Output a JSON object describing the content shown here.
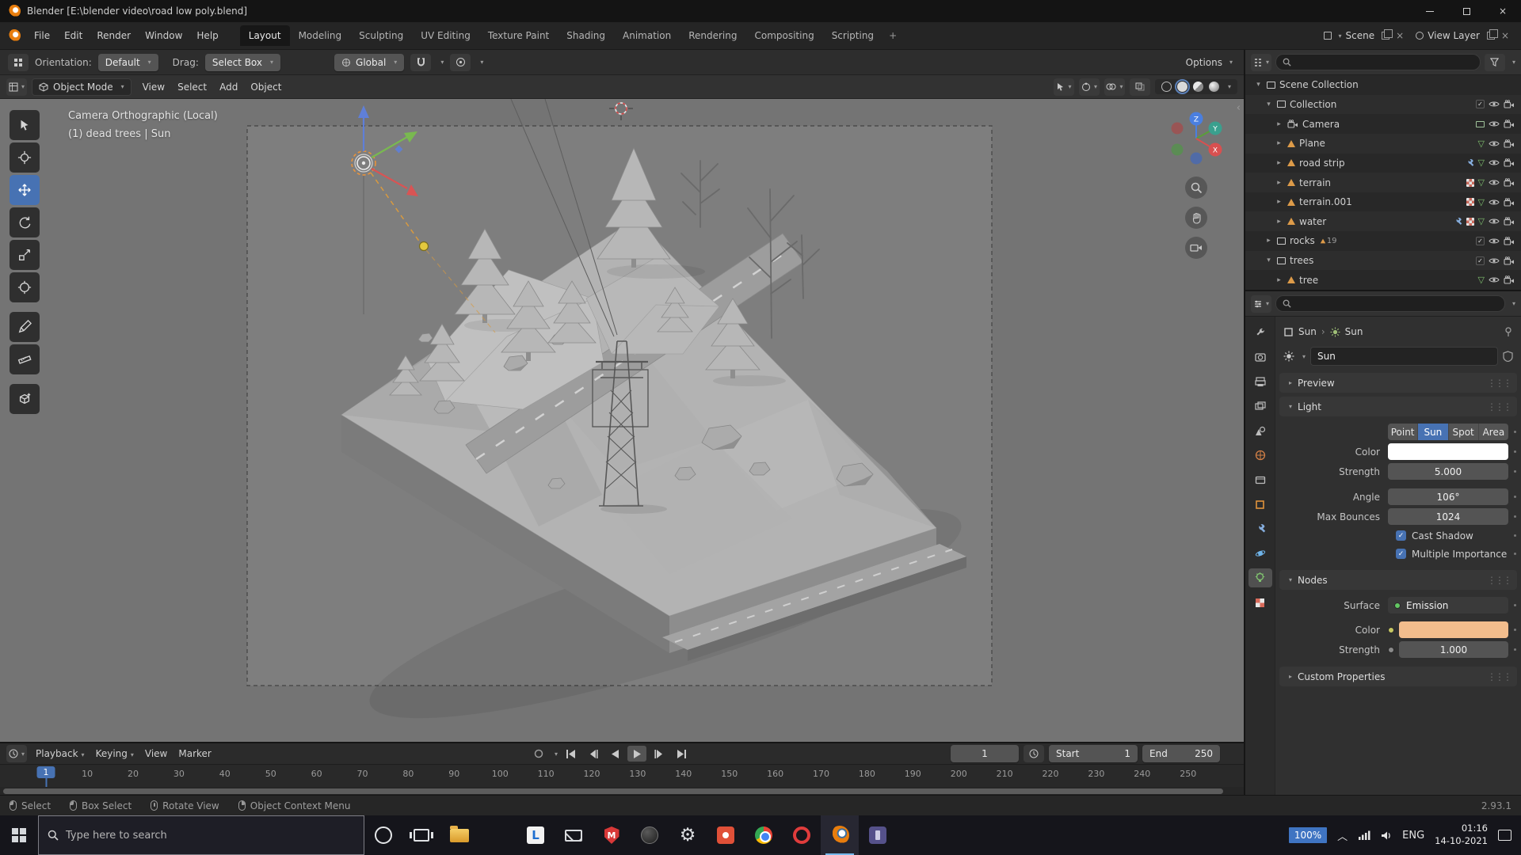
{
  "window": {
    "title": "Blender [E:\\blender video\\road low poly.blend]"
  },
  "icons": {
    "caret_down": "▾",
    "caret_right": "▸",
    "breadcrumb_sep": "›",
    "plus_tab": "+",
    "collapse_left": "‹",
    "close": "×",
    "check": "✓"
  },
  "topbar": {
    "menus": [
      "File",
      "Edit",
      "Render",
      "Window",
      "Help"
    ],
    "workspaces": [
      {
        "label": "Layout",
        "active": true
      },
      {
        "label": "Modeling"
      },
      {
        "label": "Sculpting"
      },
      {
        "label": "UV Editing"
      },
      {
        "label": "Texture Paint"
      },
      {
        "label": "Shading"
      },
      {
        "label": "Animation"
      },
      {
        "label": "Rendering"
      },
      {
        "label": "Compositing"
      },
      {
        "label": "Scripting"
      }
    ],
    "scene_label": "Scene",
    "view_layer_label": "View Layer"
  },
  "toolbar": {
    "orientation_label": "Orientation:",
    "orientation_value": "Default",
    "drag_label": "Drag:",
    "drag_value": "Select Box",
    "transform_orientation": "Global",
    "options_label": "Options"
  },
  "viewport": {
    "mode": "Object Mode",
    "menus": [
      "View",
      "Select",
      "Add",
      "Object"
    ],
    "overlay_line1": "Camera Orthographic (Local)",
    "overlay_line2": "(1) dead trees | Sun",
    "axis": {
      "x": "X",
      "y": "Y",
      "z": "Z"
    }
  },
  "outliner": {
    "rows": [
      {
        "label": "Scene Collection",
        "indent": 0,
        "icon": "scene",
        "expander": "down"
      },
      {
        "label": "Collection",
        "indent": 1,
        "icon": "collection",
        "expander": "down",
        "checkbox": true,
        "eye": true,
        "cam": true
      },
      {
        "label": "Camera",
        "indent": 2,
        "icon": "camera",
        "expander": "right",
        "extras": [
          "screen"
        ],
        "eye": true,
        "cam": true
      },
      {
        "label": "Plane",
        "indent": 2,
        "icon": "mesh",
        "expander": "right",
        "extras": [
          "data"
        ],
        "eye": true,
        "cam": true
      },
      {
        "label": "road strip",
        "indent": 2,
        "icon": "mesh",
        "expander": "right",
        "extras": [
          "mod",
          "data"
        ],
        "eye": true,
        "cam": true
      },
      {
        "label": "terrain",
        "indent": 2,
        "icon": "mesh",
        "expander": "right",
        "extras": [
          "tex",
          "data"
        ],
        "eye": true,
        "cam": true
      },
      {
        "label": "terrain.001",
        "indent": 2,
        "icon": "mesh",
        "expander": "right",
        "extras": [
          "tex",
          "data"
        ],
        "eye": true,
        "cam": true
      },
      {
        "label": "water",
        "indent": 2,
        "icon": "mesh",
        "expander": "right",
        "extras": [
          "mod",
          "tex",
          "data"
        ],
        "eye": true,
        "cam": true
      },
      {
        "label": "rocks",
        "indent": 1,
        "icon": "collection",
        "expander": "right",
        "badge": "19",
        "checkbox": true,
        "eye": true,
        "cam": true
      },
      {
        "label": "trees",
        "indent": 1,
        "icon": "collection",
        "expander": "down",
        "checkbox": true,
        "eye": true,
        "cam": true
      },
      {
        "label": "tree",
        "indent": 2,
        "icon": "mesh",
        "expander": "right",
        "extras": [
          "data"
        ],
        "eye": true,
        "cam": true
      }
    ]
  },
  "properties": {
    "breadcrumb": {
      "object": "Sun",
      "data": "Sun"
    },
    "name_value": "Sun",
    "panels": {
      "preview": "Preview",
      "light": "Light",
      "nodes": "Nodes",
      "custom_properties": "Custom Properties"
    },
    "light": {
      "types": [
        {
          "label": "Point"
        },
        {
          "label": "Sun",
          "active": true
        },
        {
          "label": "Spot"
        },
        {
          "label": "Area"
        }
      ],
      "color_label": "Color",
      "color_hex": "#ffffff",
      "strength_label": "Strength",
      "strength_value": "5.000",
      "angle_label": "Angle",
      "angle_value": "106°",
      "max_bounces_label": "Max Bounces",
      "max_bounces_value": "1024",
      "cast_shadow_label": "Cast Shadow",
      "multiple_importance_label": "Multiple Importance"
    },
    "nodes": {
      "surface_label": "Surface",
      "surface_value": "Emission",
      "color_label": "Color",
      "color_hex": "#f2bd8d",
      "strength_label": "Strength",
      "strength_value": "1.000"
    }
  },
  "timeline": {
    "menus": [
      {
        "label": "Playback",
        "caret": true
      },
      {
        "label": "Keying",
        "caret": true
      },
      {
        "label": "View"
      },
      {
        "label": "Marker"
      }
    ],
    "current_frame": "1",
    "start_label": "Start",
    "start_value": "1",
    "end_label": "End",
    "end_value": "250",
    "ticks": [
      "10",
      "20",
      "30",
      "40",
      "50",
      "60",
      "70",
      "80",
      "90",
      "100",
      "110",
      "120",
      "130",
      "140",
      "150",
      "160",
      "170",
      "180",
      "190",
      "200",
      "210",
      "220",
      "230",
      "240",
      "250"
    ]
  },
  "statusbar": {
    "hints": [
      {
        "label": "Select",
        "mouse": "left"
      },
      {
        "label": "Box Select",
        "mouse": "left"
      },
      {
        "label": "Rotate View",
        "mouse": "middle"
      },
      {
        "label": "Object Context Menu",
        "mouse": "right"
      }
    ],
    "version": "2.93.1"
  },
  "taskbar": {
    "search_placeholder": "Type here to search",
    "apps": [
      {
        "name": "cortana"
      },
      {
        "name": "task-view"
      },
      {
        "name": "file-explorer"
      },
      {
        "name": "edge"
      },
      {
        "name": "app-l",
        "glyph": "L"
      },
      {
        "name": "mail"
      },
      {
        "name": "defender",
        "glyph": "M"
      },
      {
        "name": "xbox"
      },
      {
        "name": "settings",
        "glyph": "⚙"
      },
      {
        "name": "app-red"
      },
      {
        "name": "chrome"
      },
      {
        "name": "opera"
      },
      {
        "name": "blender",
        "active": true
      },
      {
        "name": "app-dark"
      }
    ],
    "tray": {
      "scale": "100%",
      "lang": "ENG",
      "time": "01:16",
      "date": "14-10-2021"
    }
  }
}
